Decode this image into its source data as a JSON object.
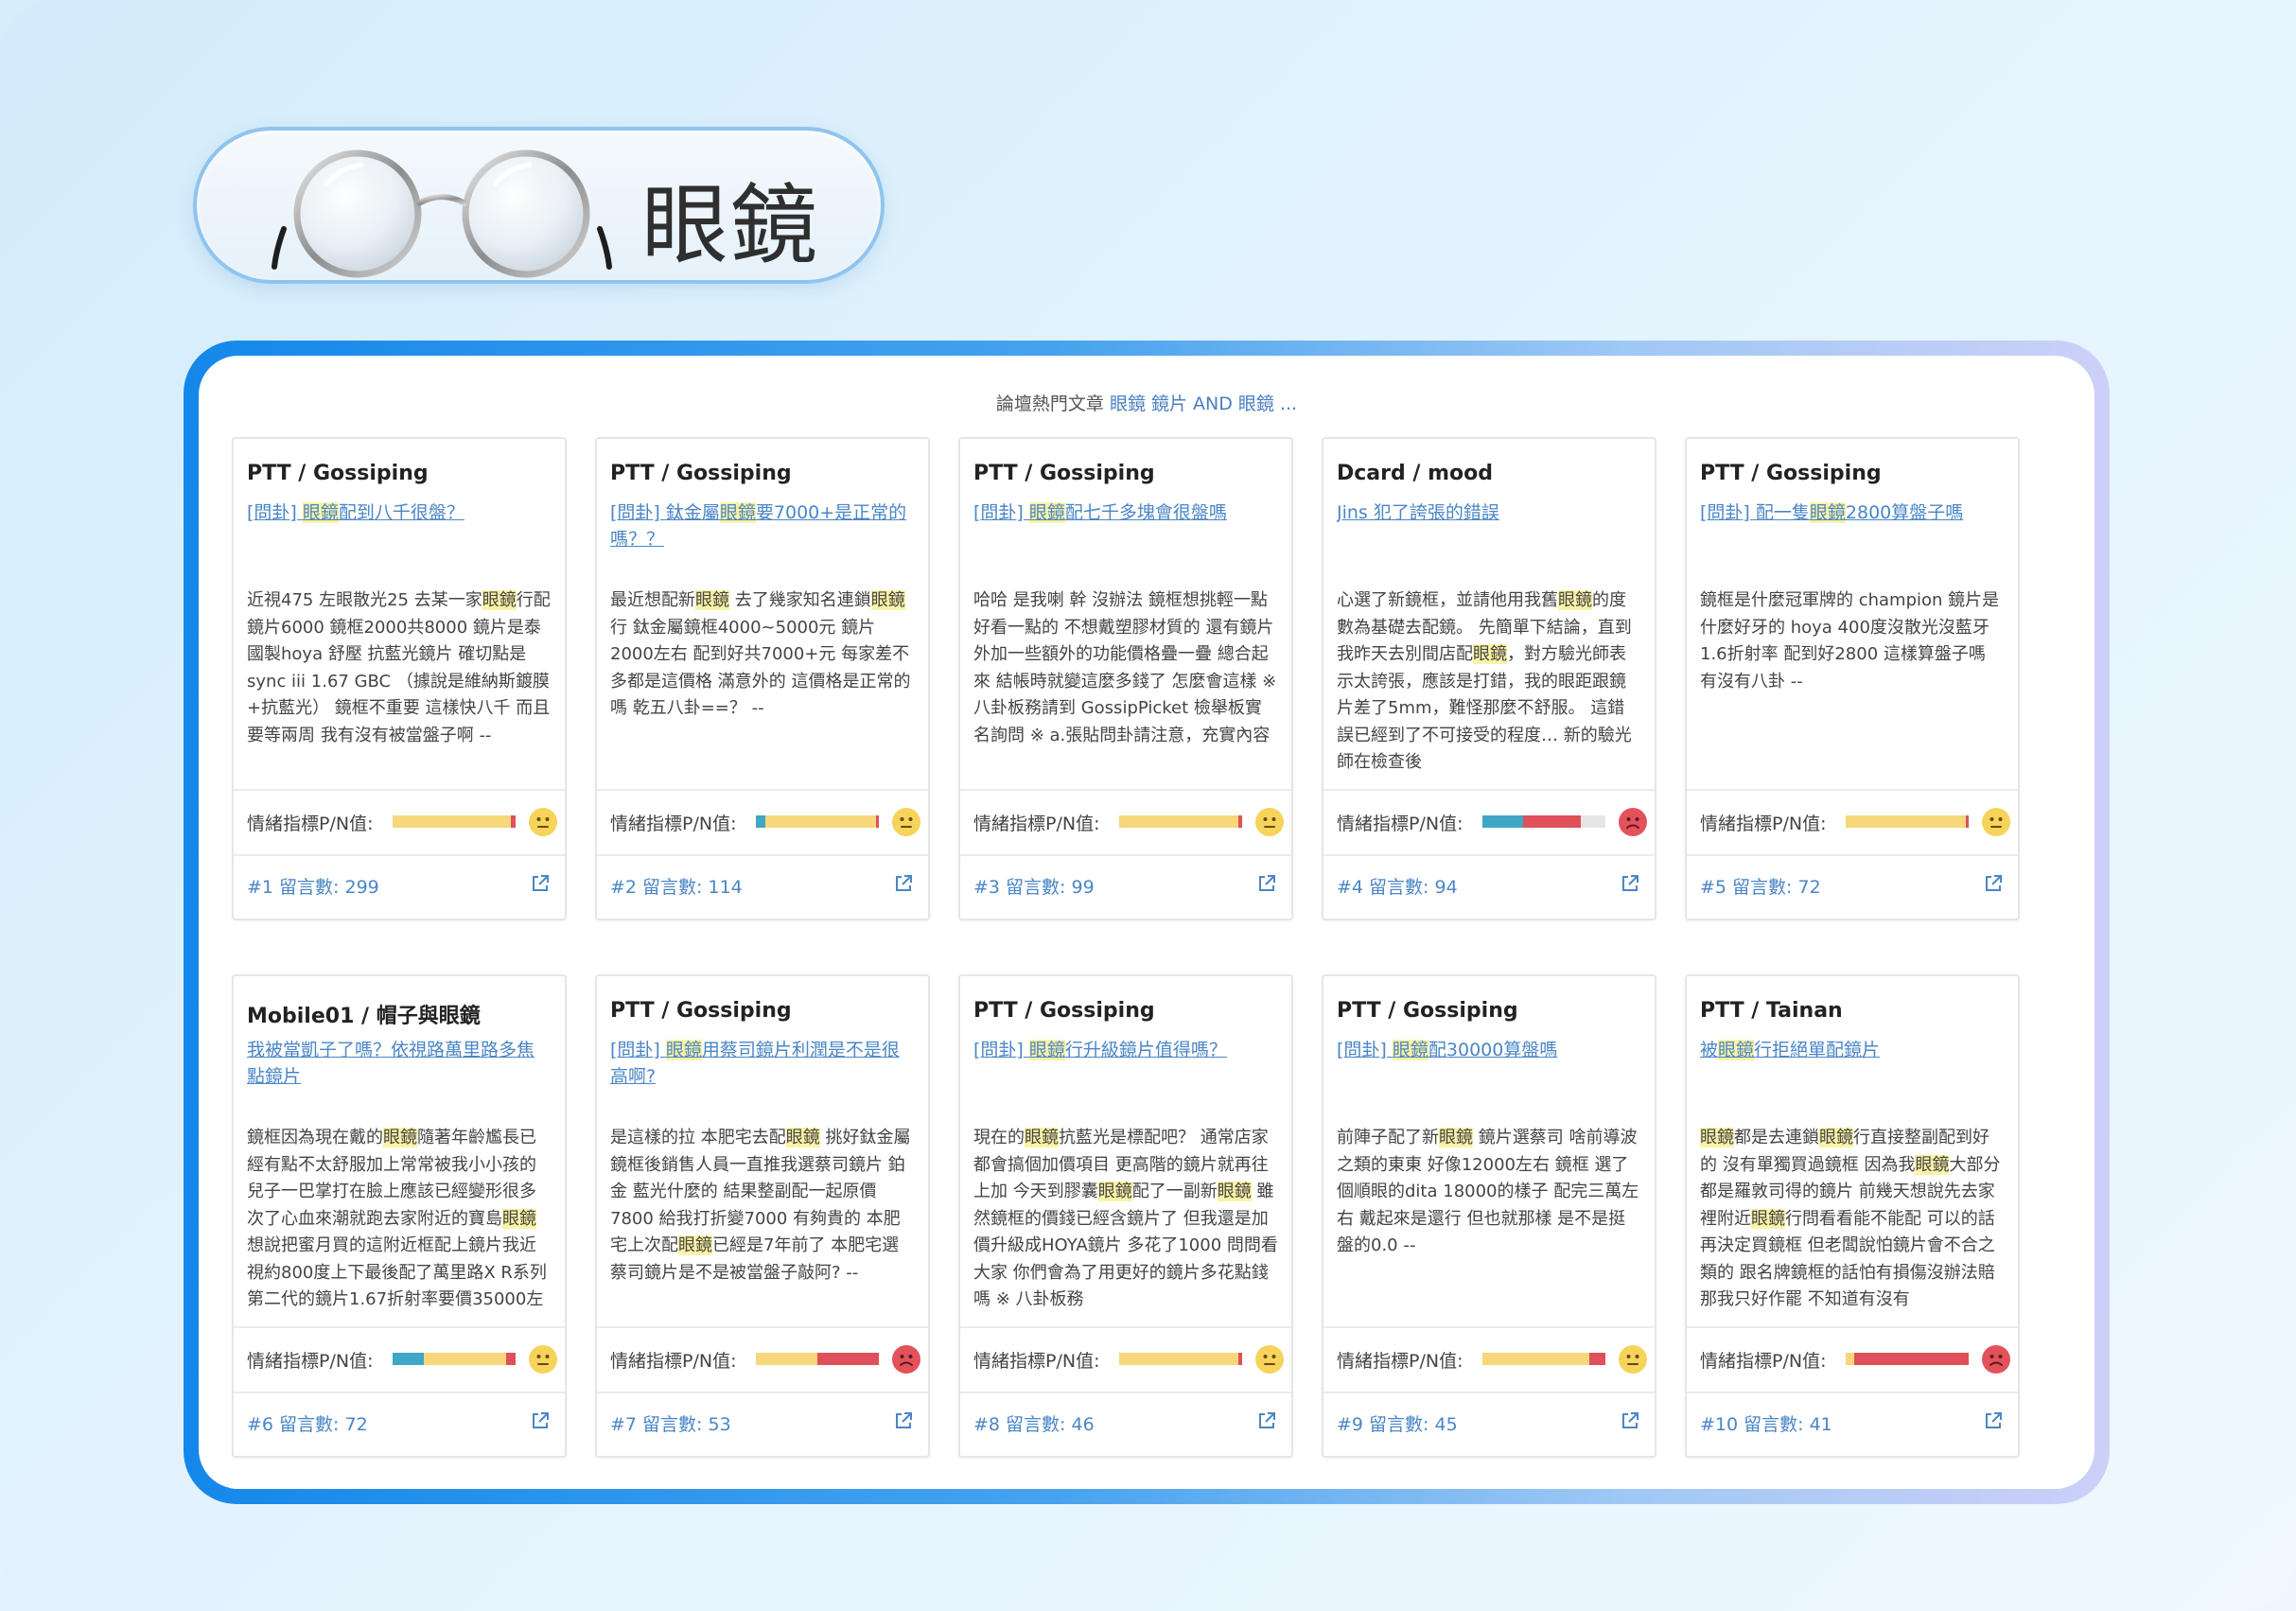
{
  "header": {
    "title": "眼鏡"
  },
  "panel": {
    "heading_prefix": "論壇熱門文章",
    "heading_query": "眼鏡 鏡片 AND 眼鏡 ..."
  },
  "sentiment_label": "情緒指標P/N值:",
  "colors": {
    "positive": "#3fa6c6",
    "neutral": "#f6d77a",
    "negative": "#e0505a",
    "link": "#4a86c6",
    "highlight": "#fbf3a6"
  },
  "cards": [
    {
      "source": "PTT / Gossiping",
      "title": [
        {
          "t": "[問卦] "
        },
        {
          "t": "眼鏡",
          "h": true
        },
        {
          "t": "配到八千很盤？"
        }
      ],
      "body": [
        {
          "t": "近視475 左眼散光25 去某一家"
        },
        {
          "t": "眼鏡",
          "h": true
        },
        {
          "t": "行配 鏡片6000 鏡框2000共8000 鏡片是泰國製hoya 舒壓 抗藍光鏡片 確切點是sync iii 1.67 GBC （據說是維納斯鍍膜+抗藍光） 鏡框不重要 這樣快八千 而且要等兩周 我有沒有被當盤子啊 --"
        }
      ],
      "bar": {
        "positive": 0,
        "neutral": 0.96,
        "negative": 0.04
      },
      "mood": "neutral",
      "count": "#1 留言數: 299"
    },
    {
      "source": "PTT / Gossiping",
      "title": [
        {
          "t": "[問卦] 鈦金屬"
        },
        {
          "t": "眼鏡",
          "h": true
        },
        {
          "t": "要7000+是正常的嗎？？"
        }
      ],
      "body": [
        {
          "t": "最近想配新"
        },
        {
          "t": "眼鏡",
          "h": true
        },
        {
          "t": " 去了幾家知名連鎖"
        },
        {
          "t": "眼鏡",
          "h": true
        },
        {
          "t": "行 鈦金屬鏡框4000~5000元 鏡片2000左右 配到好共7000+元 每家差不多都是這價格 滿意外的 這價格是正常的嗎 乾五八卦==？ --"
        }
      ],
      "bar": {
        "positive": 0.08,
        "neutral": 0.9,
        "negative": 0.02
      },
      "mood": "neutral",
      "count": "#2 留言數: 114"
    },
    {
      "source": "PTT / Gossiping",
      "title": [
        {
          "t": "[問卦] "
        },
        {
          "t": "眼鏡",
          "h": true
        },
        {
          "t": "配七千多塊會很盤嗎"
        }
      ],
      "body": [
        {
          "t": "哈哈 是我喇 幹 沒辦法 鏡框想挑輕一點好看一點的 不想戴塑膠材質的 還有鏡片外加一些額外的功能價格疊一疊 總合起來 結帳時就變這麼多錢了 怎麼會這樣 ※ 八卦板務請到 GossipPicket 檢舉板實名詢問 ※ a.張貼問卦請注意，充實內容"
        }
      ],
      "bar": {
        "positive": 0,
        "neutral": 0.97,
        "negative": 0.03
      },
      "mood": "neutral",
      "count": "#3 留言數: 99"
    },
    {
      "source": "Dcard / mood",
      "title": [
        {
          "t": "Jins 犯了誇張的錯誤"
        }
      ],
      "body": [
        {
          "t": "心選了新鏡框，並請他用我舊"
        },
        {
          "t": "眼鏡",
          "h": true
        },
        {
          "t": "的度數為基礎去配鏡。 先簡單下結論，直到我昨天去別間店配"
        },
        {
          "t": "眼鏡",
          "h": true
        },
        {
          "t": "，對方驗光師表示太誇張，應該是打錯，我的眼距跟鏡片差了5mm，難怪那麼不舒服。 這錯誤已經到了不可接受的程度… 新的驗光師在檢查後"
        }
      ],
      "bar": {
        "positive": 0.33,
        "neutral": 0,
        "negative": 0.47
      },
      "mood": "sad",
      "count": "#4 留言數: 94"
    },
    {
      "source": "PTT / Gossiping",
      "title": [
        {
          "t": "[問卦] 配一隻"
        },
        {
          "t": "眼鏡",
          "h": true
        },
        {
          "t": "2800算盤子嗎"
        }
      ],
      "body": [
        {
          "t": "鏡框是什麼冠軍牌的 champion 鏡片是什麼好牙的 hoya 400度沒散光沒藍牙 1.6折射率 配到好2800 這樣算盤子嗎 有沒有八卦 --"
        }
      ],
      "bar": {
        "positive": 0,
        "neutral": 0.98,
        "negative": 0.02
      },
      "mood": "neutral",
      "count": "#5 留言數: 72"
    },
    {
      "source": "Mobile01 / 帽子與眼鏡",
      "title": [
        {
          "t": "我被當凱子了嗎？依視路萬里路多焦點鏡片"
        }
      ],
      "body": [
        {
          "t": "鏡框因為現在戴的"
        },
        {
          "t": "眼鏡",
          "h": true
        },
        {
          "t": "隨著年齡尷長已經有點不太舒服加上常常被我小小孩的兒子一巴掌打在臉上應該已經變形很多次了心血來潮就跑去家附近的寶島"
        },
        {
          "t": "眼鏡",
          "h": true
        },
        {
          "t": "想說把蜜月買的這附近框配上鏡片我近視約800度上下最後配了萬里路X R系列第二代的鏡片1.67折射率要價35000左"
        }
      ],
      "bar": {
        "positive": 0.25,
        "neutral": 0.67,
        "negative": 0.08
      },
      "mood": "neutral",
      "count": "#6 留言數: 72"
    },
    {
      "source": "PTT / Gossiping",
      "title": [
        {
          "t": "[問卦] "
        },
        {
          "t": "眼鏡",
          "h": true
        },
        {
          "t": "用蔡司鏡片利潤是不是很高啊?"
        }
      ],
      "body": [
        {
          "t": "是這樣的拉 本肥宅去配"
        },
        {
          "t": "眼鏡",
          "h": true
        },
        {
          "t": " 挑好鈦金屬鏡框後銷售人員一直推我選蔡司鏡片 鉑金 藍光什麼的 結果整副配一起原價7800 給我打折變7000 有夠貴的 本肥宅上次配"
        },
        {
          "t": "眼鏡",
          "h": true
        },
        {
          "t": "已經是7年前了 本肥宅選蔡司鏡片是不是被當盤子敲阿? --"
        }
      ],
      "bar": {
        "positive": 0,
        "neutral": 0.5,
        "negative": 0.5
      },
      "mood": "sad",
      "count": "#7 留言數: 53"
    },
    {
      "source": "PTT / Gossiping",
      "title": [
        {
          "t": "[問卦] "
        },
        {
          "t": "眼鏡",
          "h": true
        },
        {
          "t": "行升級鏡片值得嗎？"
        }
      ],
      "body": [
        {
          "t": "現在的"
        },
        {
          "t": "眼鏡",
          "h": true
        },
        {
          "t": "抗藍光是標配吧？ 通常店家都會搞個加價項目 更高階的鏡片就再往上加 今天到膠囊"
        },
        {
          "t": "眼鏡",
          "h": true
        },
        {
          "t": "配了一副新"
        },
        {
          "t": "眼鏡",
          "h": true
        },
        {
          "t": " 雖然鏡框的價錢已經含鏡片了 但我還是加價升級成HOYA鏡片 多花了1000 問問看大家 你們會為了用更好的鏡片多花點錢嗎 ※ 八卦板務"
        }
      ],
      "bar": {
        "positive": 0,
        "neutral": 0.97,
        "negative": 0.03
      },
      "mood": "neutral",
      "count": "#8 留言數: 46"
    },
    {
      "source": "PTT / Gossiping",
      "title": [
        {
          "t": "[問卦] "
        },
        {
          "t": "眼鏡",
          "h": true
        },
        {
          "t": "配30000算盤嗎"
        }
      ],
      "body": [
        {
          "t": "前陣子配了新"
        },
        {
          "t": "眼鏡",
          "h": true
        },
        {
          "t": " 鏡片選蔡司 啥前導波之類的東東 好像12000左右 鏡框 選了個順眼的dita 18000的樣子 配完三萬左右 戴起來是還行 但也就那樣 是不是挺盤的0.0 --"
        }
      ],
      "bar": {
        "positive": 0,
        "neutral": 0.87,
        "negative": 0.13
      },
      "mood": "neutral",
      "count": "#9 留言數: 45"
    },
    {
      "source": "PTT / Tainan",
      "title": [
        {
          "t": "被"
        },
        {
          "t": "眼鏡",
          "h": true
        },
        {
          "t": "行拒絕單配鏡片"
        }
      ],
      "body": [
        {
          "t": "眼鏡",
          "h": true
        },
        {
          "t": "都是去連鎖"
        },
        {
          "t": "眼鏡",
          "h": true
        },
        {
          "t": "行直接整副配到好的 沒有單獨買過鏡框 因為我"
        },
        {
          "t": "眼鏡",
          "h": true
        },
        {
          "t": "大部分都是羅敦司得的鏡片 前幾天想說先去家裡附近"
        },
        {
          "t": "眼鏡",
          "h": true
        },
        {
          "t": "行問看看能不能配 可以的話再決定買鏡框 但老闆說怕鏡片會不合之類的 跟名牌鏡框的話怕有損傷沒辦法賠 那我只好作罷 不知道有沒有"
        }
      ],
      "bar": {
        "positive": 0,
        "neutral": 0.07,
        "negative": 0.93
      },
      "mood": "sad",
      "count": "#10 留言數: 41"
    }
  ]
}
